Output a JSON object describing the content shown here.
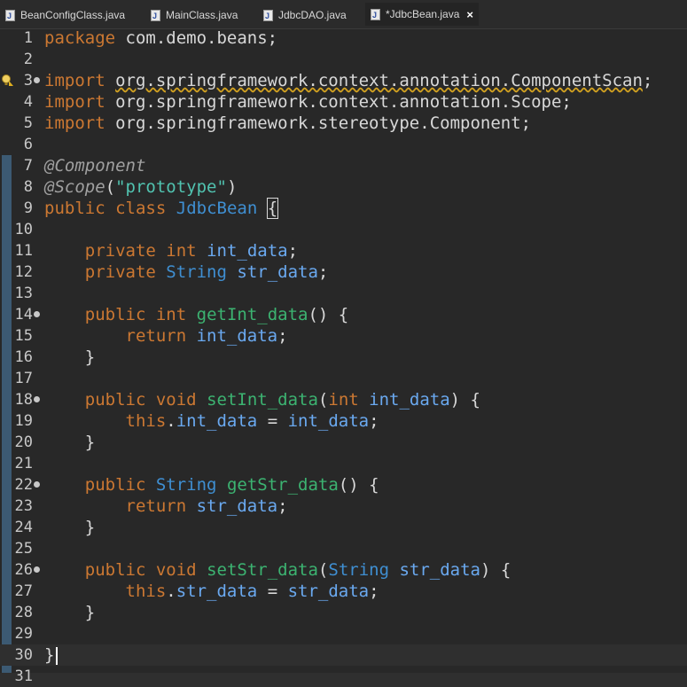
{
  "tabs": [
    {
      "label": "BeanConfigClass.java",
      "active": false
    },
    {
      "label": "MainClass.java",
      "active": false
    },
    {
      "label": "JdbcDAO.java",
      "active": false
    },
    {
      "label": "*JdbcBean.java",
      "active": true
    }
  ],
  "tab_close_icon": "×",
  "lines": [
    {
      "n": "1",
      "tokens": [
        [
          "kw",
          "package"
        ],
        [
          "plain",
          " com.demo.beans;"
        ]
      ]
    },
    {
      "n": "2",
      "tokens": []
    },
    {
      "n": "3",
      "fold": true,
      "warn": true,
      "tokens": [
        [
          "kw",
          "import"
        ],
        [
          "plain",
          " "
        ],
        [
          "squig",
          "org.springframework.context.annotation.ComponentScan"
        ],
        [
          "plain",
          ";"
        ]
      ]
    },
    {
      "n": "4",
      "tokens": [
        [
          "kw",
          "import"
        ],
        [
          "plain",
          " org.springframework.context.annotation.Scope;"
        ]
      ]
    },
    {
      "n": "5",
      "tokens": [
        [
          "kw",
          "import"
        ],
        [
          "plain",
          " org.springframework.stereotype.Component;"
        ]
      ]
    },
    {
      "n": "6",
      "tokens": []
    },
    {
      "n": "7",
      "tokens": [
        [
          "ann",
          "@Component"
        ]
      ]
    },
    {
      "n": "8",
      "tokens": [
        [
          "ann",
          "@Scope"
        ],
        [
          "plain",
          "("
        ],
        [
          "str",
          "\"prototype\""
        ],
        [
          "plain",
          ")"
        ]
      ]
    },
    {
      "n": "9",
      "tokens": [
        [
          "kw",
          "public"
        ],
        [
          "plain",
          " "
        ],
        [
          "kw",
          "class"
        ],
        [
          "plain",
          " "
        ],
        [
          "cls",
          "JdbcBean"
        ],
        [
          "plain",
          " "
        ],
        [
          "box",
          "{"
        ]
      ]
    },
    {
      "n": "10",
      "tokens": []
    },
    {
      "n": "11",
      "tokens": [
        [
          "plain",
          "    "
        ],
        [
          "kw",
          "private"
        ],
        [
          "plain",
          " "
        ],
        [
          "kw",
          "int"
        ],
        [
          "plain",
          " "
        ],
        [
          "fld",
          "int_data"
        ],
        [
          "plain",
          ";"
        ]
      ]
    },
    {
      "n": "12",
      "tokens": [
        [
          "plain",
          "    "
        ],
        [
          "kw",
          "private"
        ],
        [
          "plain",
          " "
        ],
        [
          "type",
          "String"
        ],
        [
          "plain",
          " "
        ],
        [
          "fld",
          "str_data"
        ],
        [
          "plain",
          ";"
        ]
      ]
    },
    {
      "n": "13",
      "tokens": []
    },
    {
      "n": "14",
      "fold": true,
      "tokens": [
        [
          "plain",
          "    "
        ],
        [
          "kw",
          "public"
        ],
        [
          "plain",
          " "
        ],
        [
          "kw",
          "int"
        ],
        [
          "plain",
          " "
        ],
        [
          "mth",
          "getInt_data"
        ],
        [
          "plain",
          "() {"
        ]
      ]
    },
    {
      "n": "15",
      "tokens": [
        [
          "plain",
          "        "
        ],
        [
          "kw",
          "return"
        ],
        [
          "plain",
          " "
        ],
        [
          "fld",
          "int_data"
        ],
        [
          "plain",
          ";"
        ]
      ]
    },
    {
      "n": "16",
      "tokens": [
        [
          "plain",
          "    }"
        ]
      ]
    },
    {
      "n": "17",
      "tokens": []
    },
    {
      "n": "18",
      "fold": true,
      "tokens": [
        [
          "plain",
          "    "
        ],
        [
          "kw",
          "public"
        ],
        [
          "plain",
          " "
        ],
        [
          "kw",
          "void"
        ],
        [
          "plain",
          " "
        ],
        [
          "mth",
          "setInt_data"
        ],
        [
          "plain",
          "("
        ],
        [
          "kw",
          "int"
        ],
        [
          "plain",
          " "
        ],
        [
          "fld",
          "int_data"
        ],
        [
          "plain",
          ") {"
        ]
      ]
    },
    {
      "n": "19",
      "tokens": [
        [
          "plain",
          "        "
        ],
        [
          "kw",
          "this"
        ],
        [
          "plain",
          "."
        ],
        [
          "fld",
          "int_data"
        ],
        [
          "plain",
          " = "
        ],
        [
          "fld",
          "int_data"
        ],
        [
          "plain",
          ";"
        ]
      ]
    },
    {
      "n": "20",
      "tokens": [
        [
          "plain",
          "    }"
        ]
      ]
    },
    {
      "n": "21",
      "tokens": []
    },
    {
      "n": "22",
      "fold": true,
      "tokens": [
        [
          "plain",
          "    "
        ],
        [
          "kw",
          "public"
        ],
        [
          "plain",
          " "
        ],
        [
          "type",
          "String"
        ],
        [
          "plain",
          " "
        ],
        [
          "mth",
          "getStr_data"
        ],
        [
          "plain",
          "() {"
        ]
      ]
    },
    {
      "n": "23",
      "tokens": [
        [
          "plain",
          "        "
        ],
        [
          "kw",
          "return"
        ],
        [
          "plain",
          " "
        ],
        [
          "fld",
          "str_data"
        ],
        [
          "plain",
          ";"
        ]
      ]
    },
    {
      "n": "24",
      "tokens": [
        [
          "plain",
          "    }"
        ]
      ]
    },
    {
      "n": "25",
      "tokens": []
    },
    {
      "n": "26",
      "fold": true,
      "tokens": [
        [
          "plain",
          "    "
        ],
        [
          "kw",
          "public"
        ],
        [
          "plain",
          " "
        ],
        [
          "kw",
          "void"
        ],
        [
          "plain",
          " "
        ],
        [
          "mth",
          "setStr_data"
        ],
        [
          "plain",
          "("
        ],
        [
          "type",
          "String"
        ],
        [
          "plain",
          " "
        ],
        [
          "fld",
          "str_data"
        ],
        [
          "plain",
          ") {"
        ]
      ]
    },
    {
      "n": "27",
      "tokens": [
        [
          "plain",
          "        "
        ],
        [
          "kw",
          "this"
        ],
        [
          "plain",
          "."
        ],
        [
          "fld",
          "str_data"
        ],
        [
          "plain",
          " = "
        ],
        [
          "fld",
          "str_data"
        ],
        [
          "plain",
          ";"
        ]
      ]
    },
    {
      "n": "28",
      "tokens": [
        [
          "plain",
          "    }"
        ]
      ]
    },
    {
      "n": "29",
      "tokens": []
    },
    {
      "n": "30",
      "current": true,
      "tokens": [
        [
          "plain",
          "}"
        ]
      ]
    },
    {
      "n": "31",
      "tokens": []
    }
  ]
}
